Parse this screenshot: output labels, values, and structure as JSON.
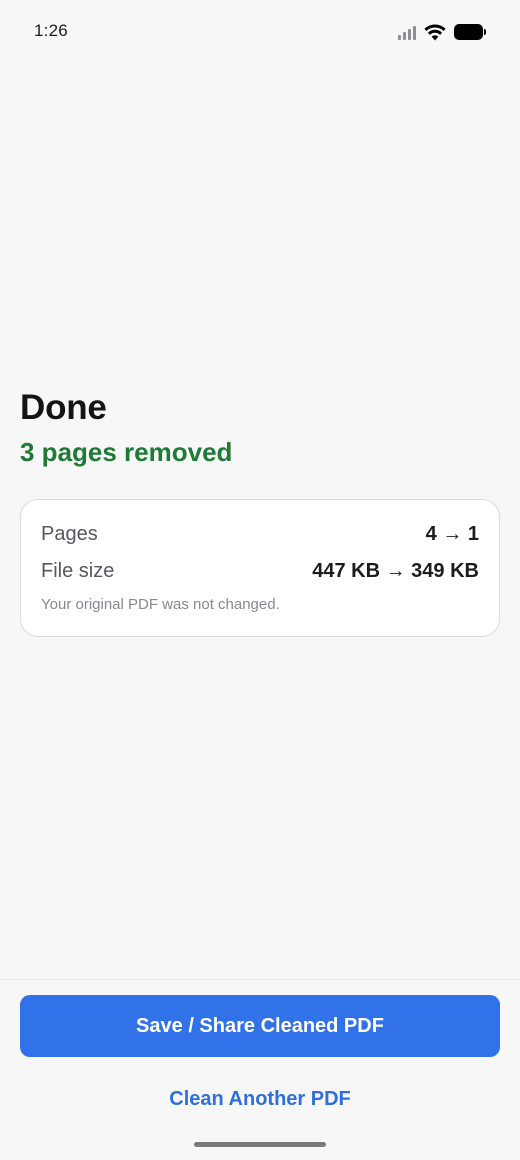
{
  "status_bar": {
    "time": "1:26"
  },
  "result": {
    "title": "Done",
    "subtitle": "3 pages removed",
    "subtitle_color": "#1e7a36"
  },
  "summary": {
    "pages_label": "Pages",
    "pages_value": "4 → 1",
    "size_label": "File size",
    "size_value": "447 KB → 349 KB",
    "note": "Your original PDF was not changed."
  },
  "actions": {
    "primary_label": "Save / Share Cleaned PDF",
    "secondary_label": "Clean Another PDF",
    "accent_color": "#3272e8"
  },
  "icons": [
    "signal-icon",
    "wifi-icon",
    "battery-icon"
  ]
}
